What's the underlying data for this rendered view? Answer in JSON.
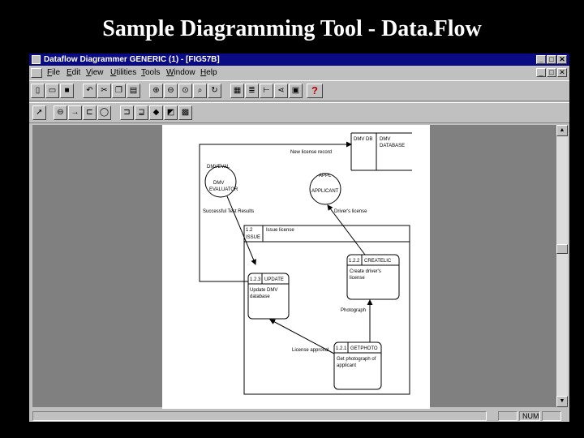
{
  "slide": {
    "title": "Sample Diagramming Tool - Data.Flow"
  },
  "window": {
    "title": "Dataflow Diagrammer GENERIC (1) - [FIG57B]",
    "controls": {
      "minimize": "_",
      "restore": "□",
      "close": "✕"
    }
  },
  "menu": {
    "items": [
      {
        "u": "F",
        "rest": "ile"
      },
      {
        "u": "E",
        "rest": "dit"
      },
      {
        "u": "V",
        "rest": "iew"
      },
      {
        "u": "U",
        "rest": "tilities"
      },
      {
        "u": "T",
        "rest": "ools"
      },
      {
        "u": "W",
        "rest": "indow"
      },
      {
        "u": "H",
        "rest": "elp"
      }
    ]
  },
  "toolbar": {
    "help_glyph": "?"
  },
  "diagram": {
    "store": {
      "id": "DMV DB",
      "name_line1": "DMV",
      "name_line2": "DATABASE"
    },
    "external_dmv": {
      "tag": "DMVEVAL",
      "line1": "DMV",
      "line2": "EVALUATOR"
    },
    "external_applicant": {
      "tag": "APPL",
      "line1": "APPLICANT"
    },
    "process_issue": {
      "id_line1": "1.2",
      "id_line2": "ISSUE",
      "name": "Issue license"
    },
    "process_create": {
      "id": "1.2.2",
      "tag": "CREATELIC",
      "line1": "Create driver's",
      "line2": "license"
    },
    "process_update": {
      "id": "1.2.3",
      "tag": "UPDATE",
      "line1": "Update DMV",
      "line2": "database"
    },
    "process_photo": {
      "id": "1.2.1",
      "tag": "GETPHOTO",
      "line1": "Get photograph of",
      "line2": "applicant"
    },
    "flows": {
      "new_license": "New license record",
      "successful": "Successful Test Results",
      "drivers_license": "Driver's license",
      "photograph": "Photograph",
      "license_approval": "License approval"
    }
  },
  "status": {
    "num": "NUM"
  }
}
